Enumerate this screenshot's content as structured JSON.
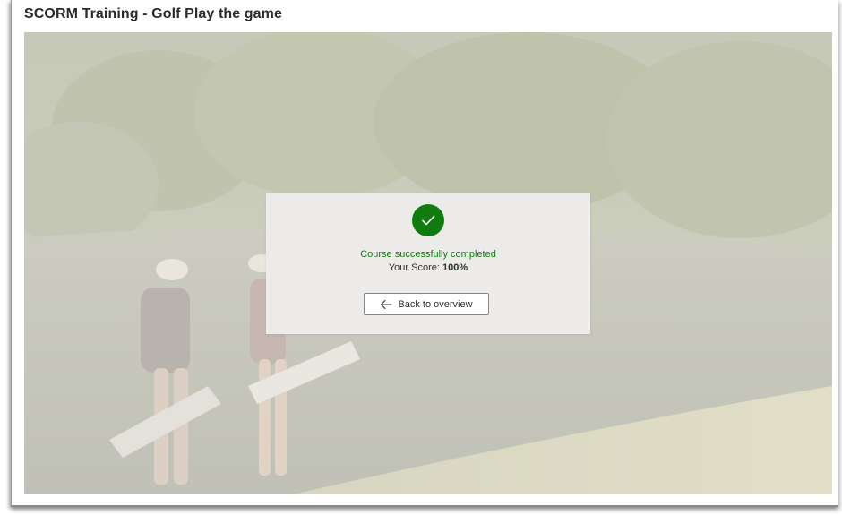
{
  "window": {
    "title": "SCORM Training - Golf Play the game"
  },
  "completion_dialog": {
    "status": "Course successfully completed",
    "score_label": "Your Score:",
    "score_value": "100%",
    "back_button_label": "Back to overview",
    "icons": {
      "status": "checkmark-icon",
      "back": "arrow-left-icon"
    }
  },
  "colors": {
    "success": "#107c10",
    "dialog_background": "#edebe9"
  }
}
